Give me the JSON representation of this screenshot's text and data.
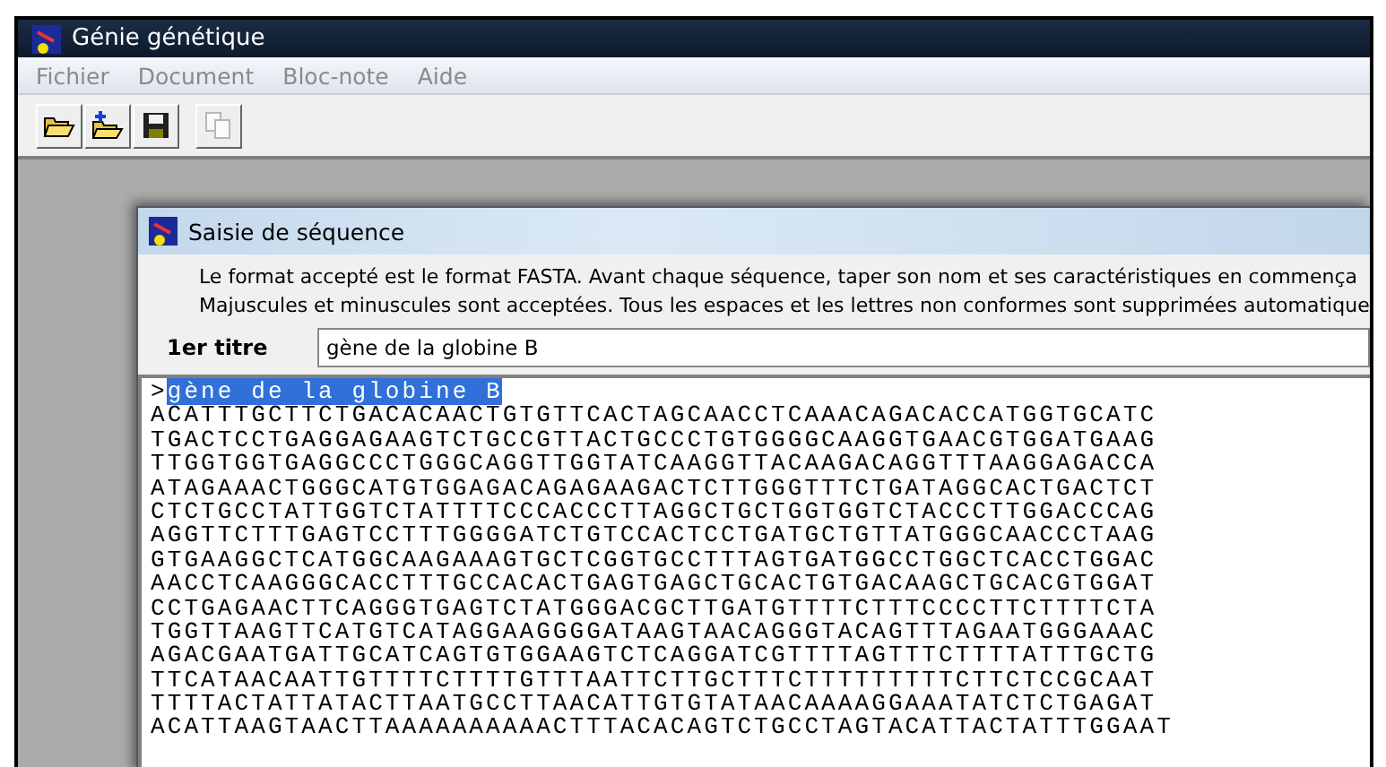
{
  "window": {
    "title": "Génie génétique"
  },
  "menu": [
    {
      "label": "Fichier"
    },
    {
      "label": "Document"
    },
    {
      "label": "Bloc-note"
    },
    {
      "label": "Aide"
    }
  ],
  "toolbar": [
    {
      "kind": "open",
      "disabled": false
    },
    {
      "kind": "new-folder",
      "disabled": false
    },
    {
      "kind": "save",
      "disabled": false
    },
    {
      "kind": "copy",
      "disabled": true
    }
  ],
  "dialog": {
    "title": "Saisie de séquence",
    "instructions": [
      "Le format accepté est le format FASTA. Avant chaque séquence, taper son nom et ses caractéristiques en commença",
      "Majuscules et minuscules sont acceptées. Tous les espaces et les lettres non conformes sont supprimées automatique"
    ],
    "title_label": "1er titre",
    "title_value": "gène de la globine B",
    "editor": {
      "prefix": ">",
      "header": "gène de la globine B",
      "header_selected": true,
      "lines": [
        "ACATTTGCTTCTGACACAACTGTGTTCACTAGCAACCTCAAACAGACACCATGGTGCATC",
        "TGACTCCTGAGGAGAAGTCTGCCGTTACTGCCCTGTGGGGCAAGGTGAACGTGGATGAAG",
        "TTGGTGGTGAGGCCCTGGGCAGGTTGGTATCAAGGTTACAAGACAGGTTTAAGGAGACCA",
        "ATAGAAACTGGGCATGTGGAGACAGAGAAGACTCTTGGGTTTCTGATAGGCACTGACTCT",
        "CTCTGCCTATTGGTCTATTTTCCCACCCTTAGGCTGCTGGTGGTCTACCCTTGGACCCAG",
        "AGGTTCTTTGAGTCCTTTGGGGATCTGTCCACTCCTGATGCTGTTATGGGCAACCCTAAG",
        "GTGAAGGCTCATGGCAAGAAAGTGCTCGGTGCCTTTAGTGATGGCCTGGCTCACCTGGAC",
        "AACCTCAAGGGCACCTTTGCCACACTGAGTGAGCTGCACTGTGACAAGCTGCACGTGGAT",
        "CCTGAGAACTTCAGGGTGAGTCTATGGGACGCTTGATGTTTTCTTTCCCCTTCTTTTCTA",
        "TGGTTAAGTTCATGTCATAGGAAGGGGATAAGTAACAGGGTACAGTTTAGAATGGGAAAC",
        "AGACGAATGATTGCATCAGTGTGGAAGTCTCAGGATCGTTTTAGTTTCTTTTATTTGCTG",
        "TTCATAACAATTGTTTTCTTTTGTTTAATTCTTGCTTTCTTTTTTTTTCTTCTCCGCAAT",
        "TTTTACTATTATACTTAATGCCTTAACATTGTGTATAACAAAAGGAAATATCTCTGAGAT",
        "ACATTAAGTAACTTAAAAAAAAAACTTTACACAGTCTGCCTAGTACATTACTATTTGGAAT"
      ]
    }
  }
}
